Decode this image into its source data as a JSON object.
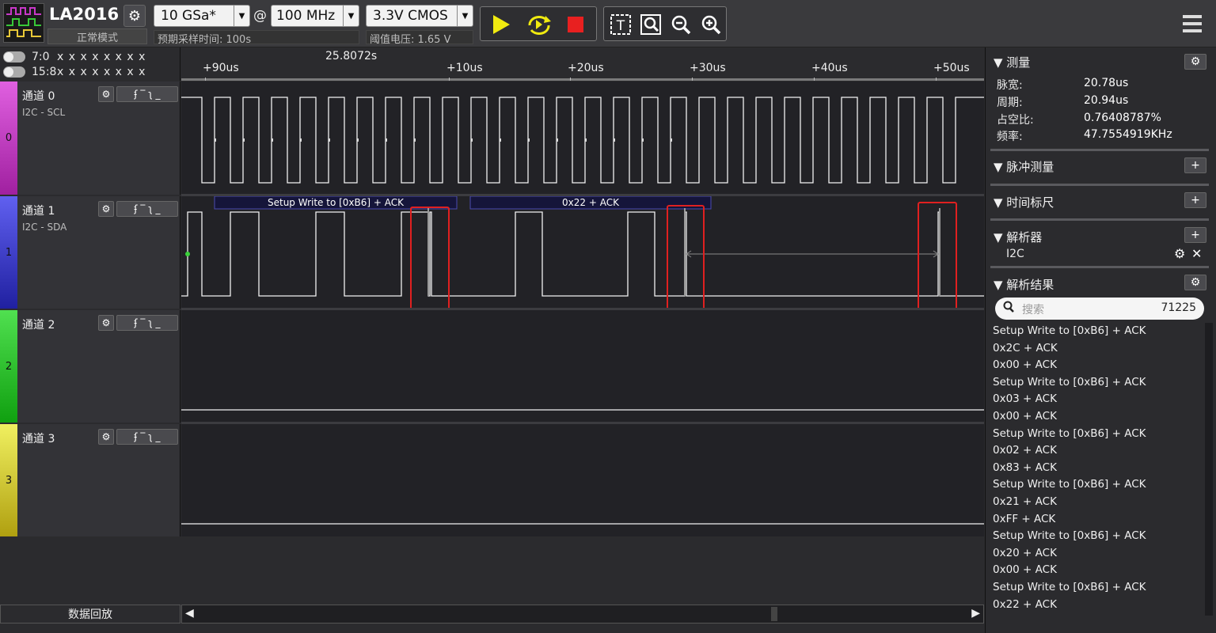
{
  "toolbar": {
    "device_name": "LA2016",
    "device_mode": "正常模式",
    "sample_rate": "10 GSa*",
    "at_sign": "@",
    "depth": "100 MHz",
    "voltage_standard": "3.3V CMOS",
    "expected_time_label": "预期采样时间: 100s",
    "threshold_label": "阈值电压: 1.65 V"
  },
  "mask": {
    "row1_label": "7:0",
    "row1_bits": "x x x x x x x x",
    "row2_label": "15:8",
    "row2_bits": "x x x x x x x x"
  },
  "ruler": {
    "center_time": "25.8072s",
    "ticks": [
      "+90us",
      "+10us",
      "+20us",
      "+30us",
      "+40us",
      "+50us"
    ]
  },
  "channels": [
    {
      "index": "0",
      "name": "通道 0",
      "sub": "I2C - SCL",
      "color": "#c838c8"
    },
    {
      "index": "1",
      "name": "通道 1",
      "sub": "I2C - SDA",
      "color": "#3838c8"
    },
    {
      "index": "2",
      "name": "通道 2",
      "sub": "",
      "color": "#38c838"
    },
    {
      "index": "3",
      "name": "通道 3",
      "sub": "",
      "color": "#d8d838"
    }
  ],
  "decode_labels": [
    {
      "text": "Setup Write to [0xB6] + ACK"
    },
    {
      "text": "0x22 + ACK"
    }
  ],
  "panel": {
    "measure": {
      "title": "▼ 测量",
      "rows": [
        {
          "label": "脉宽:",
          "value": "20.78us"
        },
        {
          "label": "周期:",
          "value": "20.94us"
        },
        {
          "label": "占空比:",
          "value": "0.76408787%"
        },
        {
          "label": "频率:",
          "value": "47.7554919KHz"
        }
      ]
    },
    "pulse_title": "▼ 脉冲测量",
    "ruler_title": "▼ 时间标尺",
    "decoder_title": "▼ 解析器",
    "decoder_item": "I2C",
    "results_title": "▼ 解析结果",
    "search_placeholder": "搜索",
    "result_count": "71225",
    "results": [
      "Setup Write to [0xB6] + ACK",
      "0x2C + ACK",
      "0x00 + ACK",
      "Setup Write to [0xB6] + ACK",
      "0x03 + ACK",
      "0x00 + ACK",
      "Setup Write to [0xB6] + ACK",
      "0x02 + ACK",
      "0x83 + ACK",
      "Setup Write to [0xB6] + ACK",
      "0x21 + ACK",
      "0xFF + ACK",
      "Setup Write to [0xB6] + ACK",
      "0x20 + ACK",
      "0x00 + ACK",
      "Setup Write to [0xB6] + ACK",
      "0x22 + ACK"
    ]
  },
  "bottom": {
    "replay_label": "数据回放",
    "scroll_left": "◀",
    "scroll_right": "▶"
  }
}
